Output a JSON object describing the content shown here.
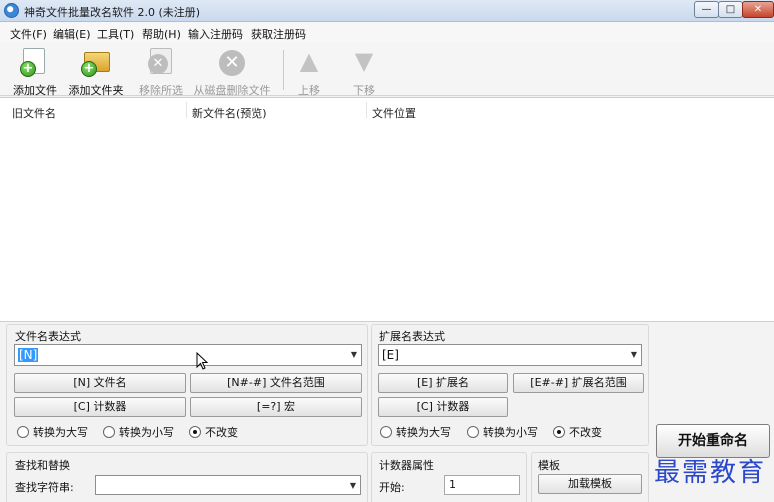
{
  "window": {
    "title": "神奇文件批量改名软件 2.0 (未注册)",
    "min": "—",
    "max": "□",
    "close": "✕"
  },
  "menu": [
    "文件(F)",
    "编辑(E)",
    "工具(T)",
    "帮助(H)",
    "输入注册码",
    "获取注册码"
  ],
  "toolbar": {
    "add_file": "添加文件",
    "add_folder": "添加文件夹",
    "remove_selected": "移除所选",
    "delete_from_disk": "从磁盘删除文件",
    "move_up": "上移",
    "move_down": "下移"
  },
  "filelist": {
    "columns": [
      "旧文件名",
      "新文件名(预览)",
      "文件位置"
    ]
  },
  "name_expr": {
    "title": "文件名表达式",
    "value": "[N]",
    "buttons": [
      "[N] 文件名",
      "[N#-#] 文件名范围",
      "[C] 计数器",
      "[=?] 宏"
    ],
    "radios": [
      "转换为大写",
      "转换为小写",
      "不改变"
    ],
    "selected_radio": 2
  },
  "ext_expr": {
    "title": "扩展名表达式",
    "value": "[E]",
    "buttons": [
      "[E] 扩展名",
      "[E#-#] 扩展名范围",
      "[C] 计数器"
    ],
    "radios": [
      "转换为大写",
      "转换为小写",
      "不改变"
    ],
    "selected_radio": 2
  },
  "start_button": "开始重命名",
  "find_replace": {
    "title": "查找和替换",
    "find_label": "查找字符串:"
  },
  "counter": {
    "title": "计数器属性",
    "start_label": "开始:",
    "start_value": "1"
  },
  "template": {
    "title": "模板",
    "load_button": "加载模板"
  },
  "watermark": "最需教育"
}
